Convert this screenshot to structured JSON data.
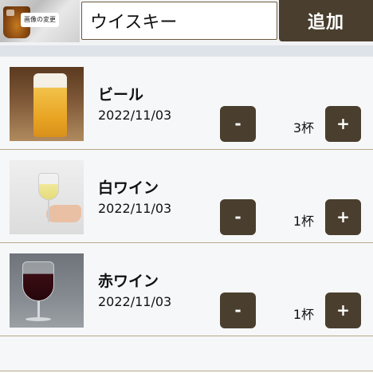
{
  "header": {
    "image_button_label": "画像の変更",
    "name_input_value": "ウイスキー",
    "add_button_label": "追加"
  },
  "drinks": [
    {
      "name": "ビール",
      "date": "2022/11/03",
      "count": "3杯",
      "minus_label": "-",
      "plus_label": "+",
      "image": "beer-glass"
    },
    {
      "name": "白ワイン",
      "date": "2022/11/03",
      "count": "1杯",
      "minus_label": "-",
      "plus_label": "+",
      "image": "white-wine-glass"
    },
    {
      "name": "赤ワイン",
      "date": "2022/11/03",
      "count": "1杯",
      "minus_label": "-",
      "plus_label": "+",
      "image": "red-wine-glass"
    }
  ]
}
